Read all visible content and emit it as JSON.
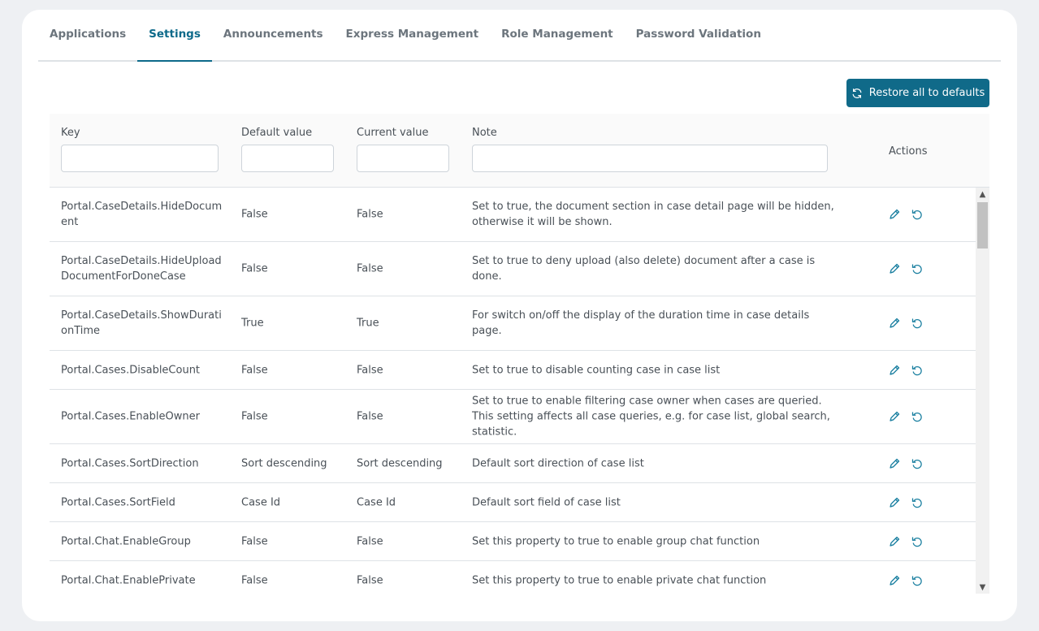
{
  "tabs": [
    {
      "label": "Applications",
      "active": false
    },
    {
      "label": "Settings",
      "active": true
    },
    {
      "label": "Announcements",
      "active": false
    },
    {
      "label": "Express Management",
      "active": false
    },
    {
      "label": "Role Management",
      "active": false
    },
    {
      "label": "Password Validation",
      "active": false
    }
  ],
  "toolbar": {
    "restore_label": "Restore all to defaults"
  },
  "table": {
    "headers": {
      "key": "Key",
      "default": "Default value",
      "current": "Current value",
      "note": "Note",
      "actions": "Actions"
    },
    "rows": [
      {
        "key": "Portal.CaseDetails.HideDocument",
        "default": "False",
        "current": "False",
        "note": "Set to true, the document section in case detail page will be hidden, otherwise it will be shown."
      },
      {
        "key": "Portal.CaseDetails.HideUploadDocumentForDoneCase",
        "default": "False",
        "current": "False",
        "note": "Set to true to deny upload (also delete) document after a case is done."
      },
      {
        "key": "Portal.CaseDetails.ShowDurationTime",
        "default": "True",
        "current": "True",
        "note": "For switch on/off the display of the duration time in case details page."
      },
      {
        "key": "Portal.Cases.DisableCount",
        "default": "False",
        "current": "False",
        "note": "Set to true to disable counting case in case list"
      },
      {
        "key": "Portal.Cases.EnableOwner",
        "default": "False",
        "current": "False",
        "note": "Set to true to enable filtering case owner when cases are queried. This setting affects all case queries, e.g. for case list, global search, statistic."
      },
      {
        "key": "Portal.Cases.SortDirection",
        "default": "Sort descending",
        "current": "Sort descending",
        "note": "Default sort direction of case list"
      },
      {
        "key": "Portal.Cases.SortField",
        "default": "Case Id",
        "current": "Case Id",
        "note": "Default sort field of case list"
      },
      {
        "key": "Portal.Chat.EnableGroup",
        "default": "False",
        "current": "False",
        "note": "Set this property to true to enable group chat function"
      },
      {
        "key": "Portal.Chat.EnablePrivate",
        "default": "False",
        "current": "False",
        "note": "Set this property to true to enable private chat function"
      }
    ]
  },
  "colors": {
    "accent": "#106a89",
    "icon": "#1a7fa0"
  },
  "icons": {
    "edit": "pencil-icon",
    "reset": "undo-icon",
    "restore": "refresh-icon"
  }
}
